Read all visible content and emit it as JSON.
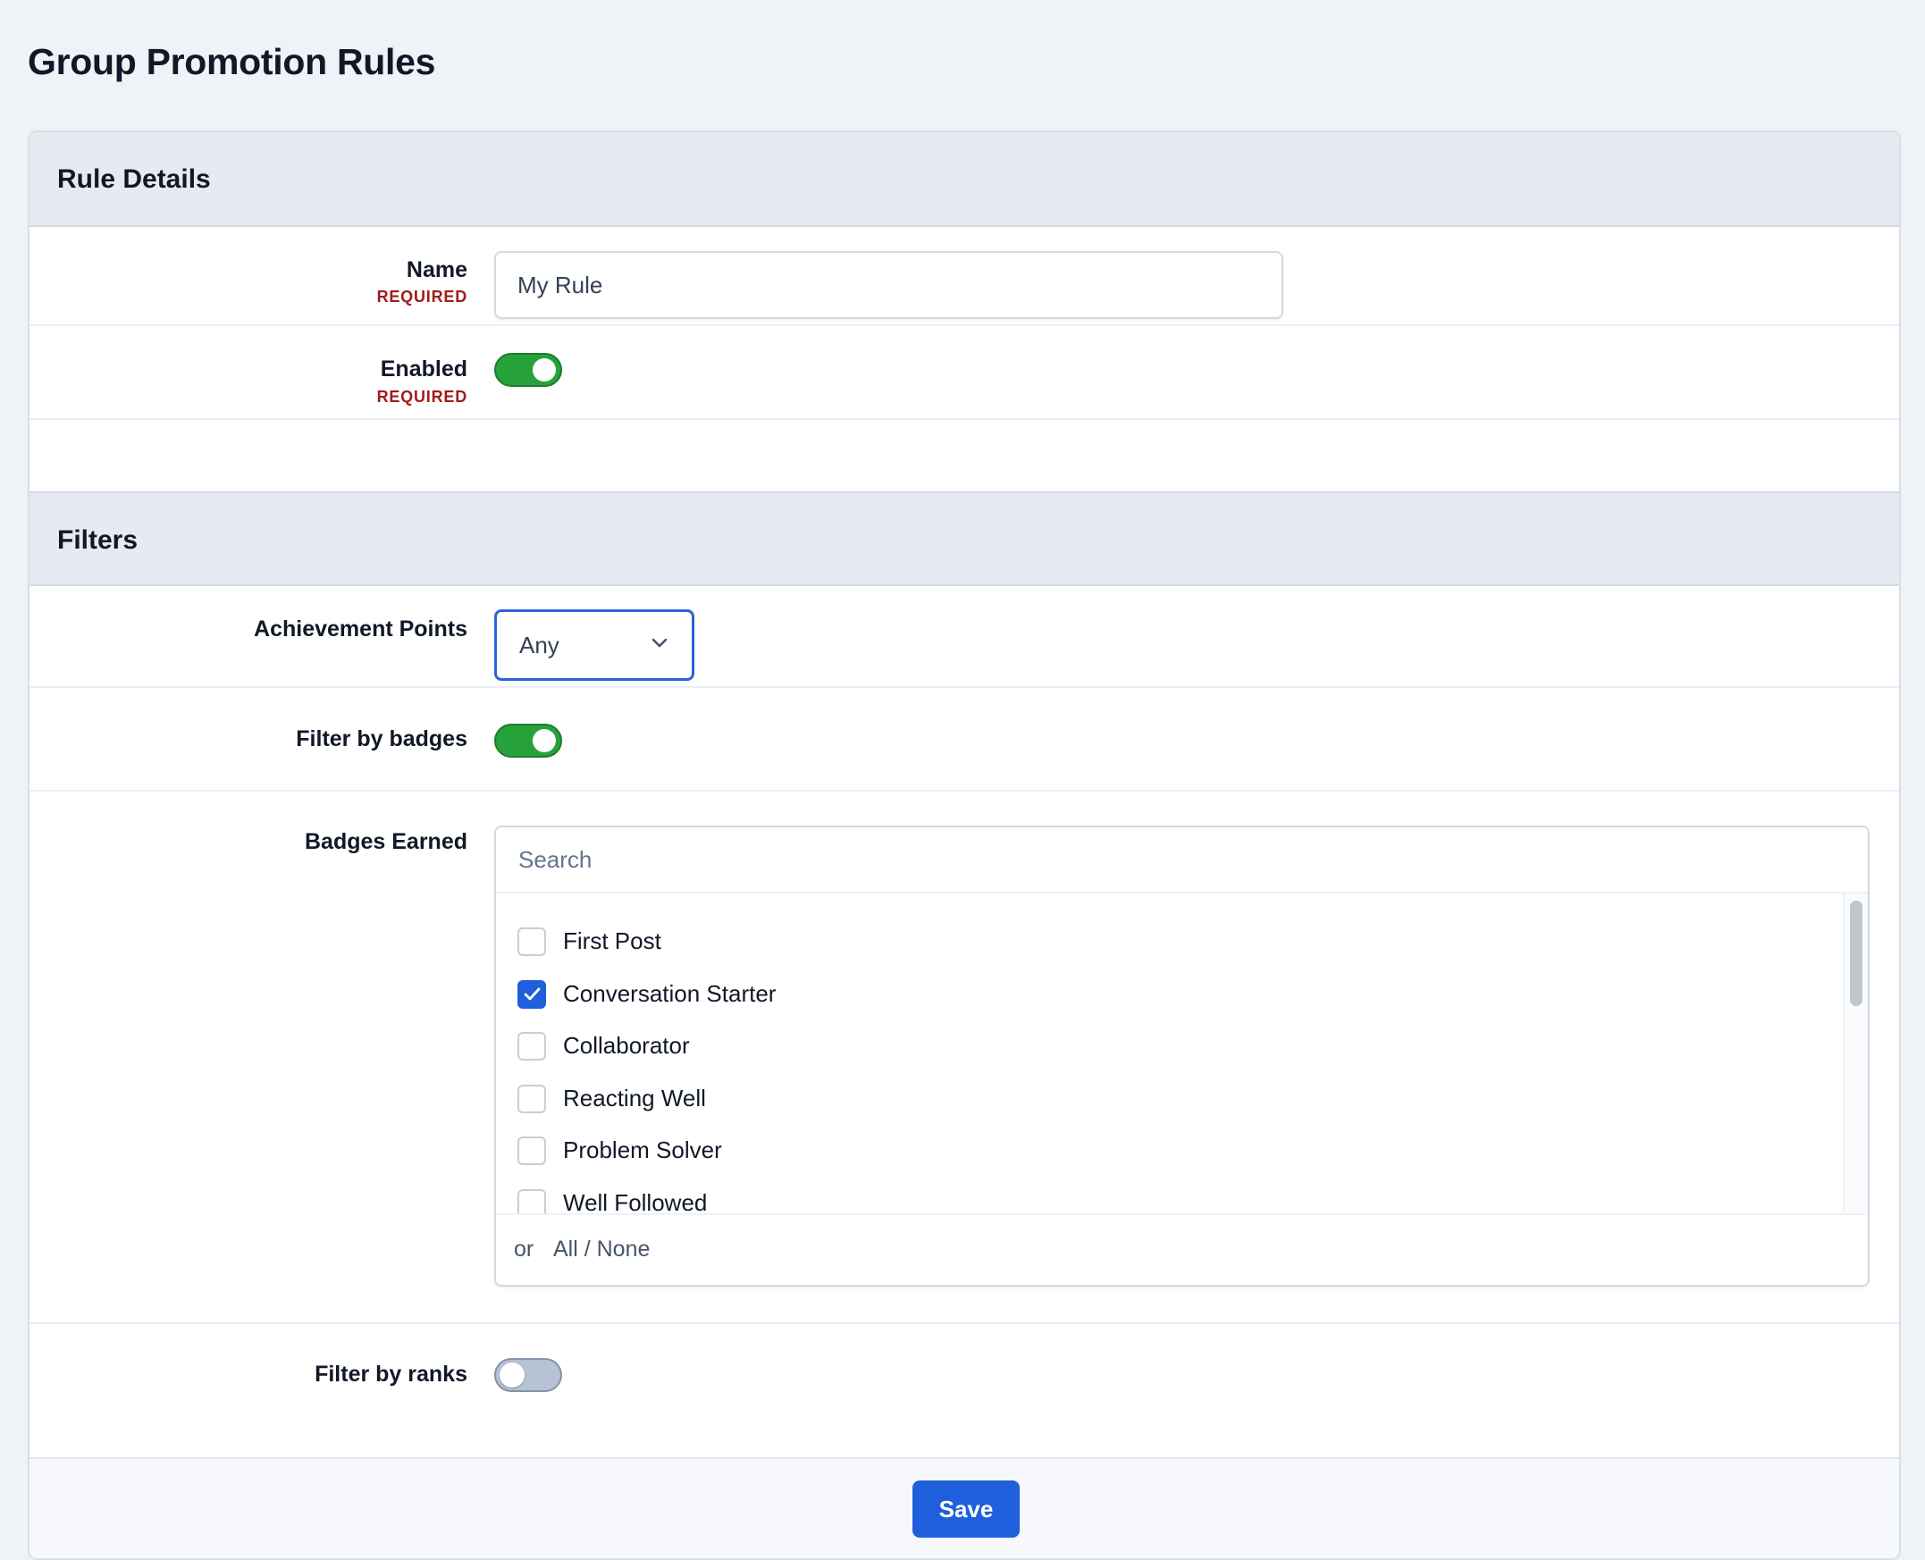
{
  "page": {
    "title": "Group Promotion Rules"
  },
  "rule_details": {
    "section_title": "Rule Details",
    "name": {
      "label": "Name",
      "required_text": "REQUIRED",
      "value": "My Rule"
    },
    "enabled": {
      "label": "Enabled",
      "required_text": "REQUIRED",
      "state": "on"
    }
  },
  "filters": {
    "section_title": "Filters",
    "achievement_points": {
      "label": "Achievement Points",
      "selected": "Any"
    },
    "filter_by_badges": {
      "label": "Filter by badges",
      "state": "on"
    },
    "badges_earned": {
      "label": "Badges Earned",
      "search_placeholder": "Search",
      "options": [
        {
          "label": "First Post",
          "checked": false
        },
        {
          "label": "Conversation Starter",
          "checked": true
        },
        {
          "label": "Collaborator",
          "checked": false
        },
        {
          "label": "Reacting Well",
          "checked": false
        },
        {
          "label": "Problem Solver",
          "checked": false
        },
        {
          "label": "Well Followed",
          "checked": false
        }
      ],
      "footer_or": "or",
      "footer_all_none": "All / None"
    },
    "filter_by_ranks": {
      "label": "Filter by ranks",
      "state": "off"
    }
  },
  "actions": {
    "save_label": "Save"
  },
  "colors": {
    "accent": "#1f5fdb",
    "toggle_on": "#27a23b",
    "toggle_off": "#b7c3d4",
    "required": "#a31b1b",
    "page_bg": "#eff2f7",
    "section_bg": "#e6eaf1"
  }
}
